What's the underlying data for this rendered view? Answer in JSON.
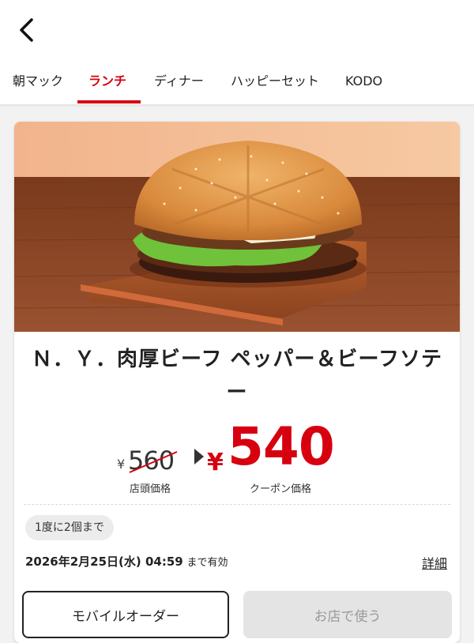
{
  "nav": {
    "back_icon": "chevron-left-icon"
  },
  "tabs": [
    {
      "label": "朝マック"
    },
    {
      "label": "ランチ",
      "active": true
    },
    {
      "label": "ディナー"
    },
    {
      "label": "ハッピーセット"
    },
    {
      "label": "KODO"
    }
  ],
  "coupon": {
    "title": "Ｎ．Ｙ．肉厚ビーフ ペッパー＆ビーフソテー",
    "original_currency": "¥",
    "original_price": "560",
    "original_price_label": "店頭価格",
    "coupon_currency": "¥",
    "coupon_price": "540",
    "coupon_price_label": "クーポン価格",
    "limit_text": "1度に2個まで",
    "expiry_date": "2026年2月25日(水) 04:59",
    "expiry_suffix": "まで有効",
    "detail_link": "詳細",
    "mobile_order_label": "モバイルオーダー",
    "use_in_store_label": "お店で使う"
  },
  "colors": {
    "accent": "#d7000f",
    "disabled_bg": "#e4e4e4"
  }
}
